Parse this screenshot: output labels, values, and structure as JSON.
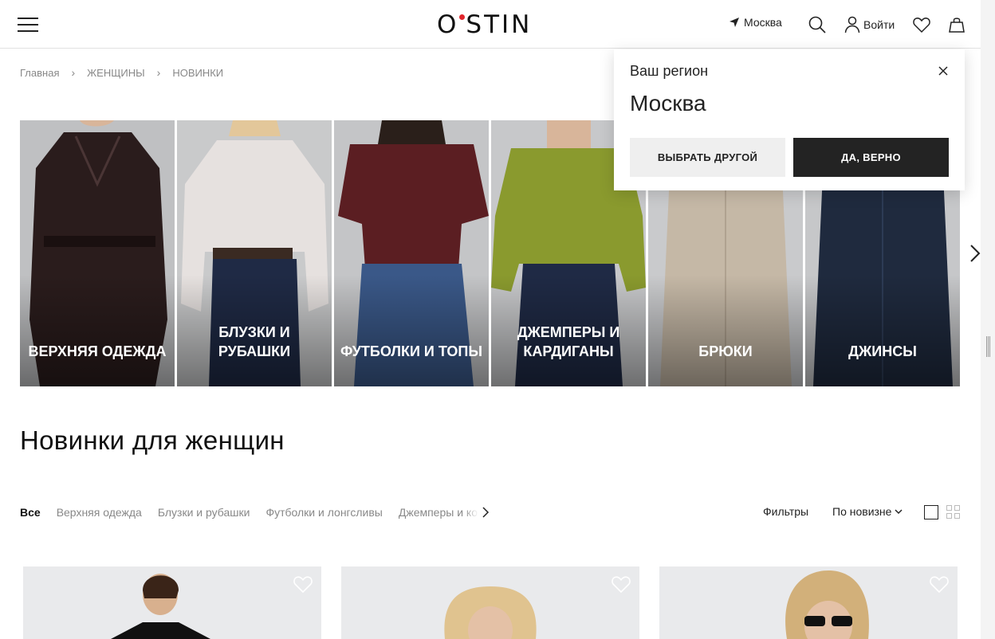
{
  "header": {
    "logo_text": "O STIN",
    "logo_left": "O",
    "logo_right": "STIN",
    "logo_dot_color": "#e0252b",
    "location": "Москва",
    "login": "Войти",
    "icons": [
      "menu-icon",
      "location-arrow-icon",
      "search-icon",
      "user-icon",
      "heart-icon",
      "bag-icon"
    ]
  },
  "breadcrumb": {
    "items": [
      "Главная",
      "ЖЕНЩИНЫ",
      "НОВИНКИ"
    ],
    "separator": "›"
  },
  "categories": [
    {
      "label": "ВЕРХНЯЯ ОДЕЖДА",
      "bg": "#bfc0c2",
      "garment": "#2a1c1c"
    },
    {
      "label": "БЛУЗКИ И РУБАШКИ",
      "bg": "#c9cacb",
      "garment": "#e6e1df"
    },
    {
      "label": "ФУТБОЛКИ И ТОПЫ",
      "bg": "#c4c5c7",
      "garment": "#5b1e22"
    },
    {
      "label": "ДЖЕМПЕРЫ И КАРДИГАНЫ",
      "bg": "#c7c8ca",
      "garment": "#8a9a2e"
    },
    {
      "label": "БРЮКИ",
      "bg": "#c9cacc",
      "garment": "#c5b8a6"
    },
    {
      "label": "ДЖИНСЫ",
      "bg": "#c6c7c9",
      "garment": "#1f2a3e"
    }
  ],
  "section": {
    "title": "Новинки для женщин"
  },
  "tabs": {
    "items": [
      "Все",
      "Верхняя одежда",
      "Блузки и рубашки",
      "Футболки и лонгсливы",
      "Джемперы и ко"
    ],
    "active": "Все"
  },
  "toolbar": {
    "filters": "Фильтры",
    "sort": "По новизне"
  },
  "region_popup": {
    "title": "Ваш регион",
    "city": "Москва",
    "choose_other": "ВЫБРАТЬ ДРУГОЙ",
    "confirm": "ДА, ВЕРНО"
  }
}
